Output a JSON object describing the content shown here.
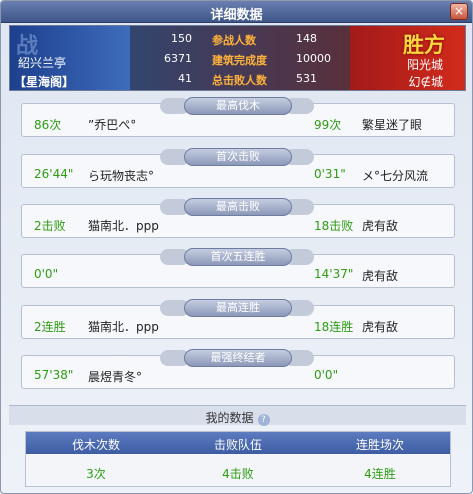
{
  "title": "详细数据",
  "close": "×",
  "blue": {
    "team": "紹兴兰亭",
    "server": "【星海阁】",
    "ghost": "战"
  },
  "red": {
    "result": "胜方",
    "team": "阳光城",
    "server": "幻∉城"
  },
  "stats": [
    {
      "left": "150",
      "label": "参战人数",
      "right": "148"
    },
    {
      "left": "6371",
      "label": "建筑完成度",
      "right": "10000"
    },
    {
      "left": "41",
      "label": "总击败人数",
      "right": "531"
    }
  ],
  "sections": [
    {
      "header": "最高伐木",
      "left_val": "86次",
      "left_name": "”乔巴ぺ°",
      "right_val": "99次",
      "right_name": "繁星迷了眼"
    },
    {
      "header": "首次击败",
      "left_val": "26'44\"",
      "left_name": "ら玩物丧志°",
      "right_val": "0'31\"",
      "right_name": "メ°七分风流"
    },
    {
      "header": "最高击败",
      "left_val": "2击败",
      "left_name": "猫南北．ppp",
      "right_val": "18击败",
      "right_name": "虎有敌"
    },
    {
      "header": "首次五连胜",
      "left_val": "0'0\"",
      "left_name": "",
      "right_val": "14'37\"",
      "right_name": "虎有敌"
    },
    {
      "header": "最高连胜",
      "left_val": "2连胜",
      "left_name": "猫南北．ppp",
      "right_val": "18连胜",
      "right_name": "虎有敌"
    },
    {
      "header": "最强终结者",
      "left_val": "57'38\"",
      "left_name": "晨煜青冬°",
      "right_val": "0'0\"",
      "right_name": ""
    }
  ],
  "my_data": {
    "title": "我的数据",
    "help": "?",
    "headers": [
      "伐木次数",
      "击败队伍",
      "连胜场次"
    ],
    "values": [
      "3次",
      "4击败",
      "4连胜"
    ]
  }
}
